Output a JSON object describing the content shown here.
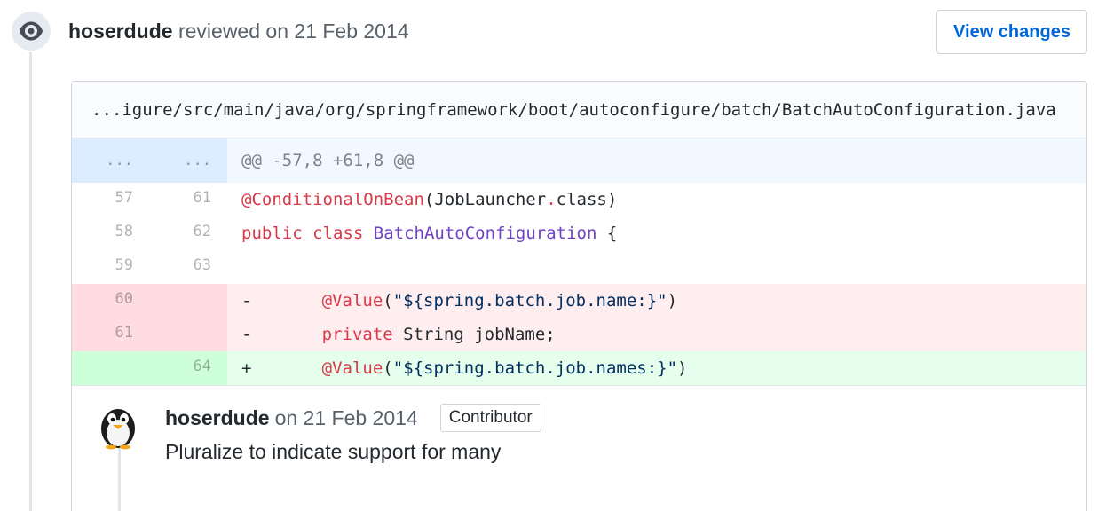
{
  "review": {
    "author": "hoserdude",
    "action": " reviewed on 21 Feb 2014",
    "view_changes_label": "View changes"
  },
  "file": {
    "path": "...igure/src/main/java/org/springframework/boot/autoconfigure/batch/BatchAutoConfiguration.java"
  },
  "hunk": {
    "left": "...",
    "right": "...",
    "header": "@@ -57,8 +61,8 @@"
  },
  "lines": [
    {
      "type": "ctx",
      "old": "57",
      "new": "61"
    },
    {
      "type": "ctx",
      "old": "58",
      "new": "62"
    },
    {
      "type": "ctx",
      "old": "59",
      "new": "63"
    },
    {
      "type": "del",
      "old": "60",
      "new": ""
    },
    {
      "type": "del",
      "old": "61",
      "new": ""
    },
    {
      "type": "add",
      "old": "",
      "new": "64"
    }
  ],
  "code": {
    "l1": {
      "annotation": "@ConditionalOnBean",
      "open": "(JobLauncher",
      "dot": ".",
      "rest": "class)"
    },
    "l2": {
      "kw1": "public",
      "kw2": "class",
      "name": "BatchAutoConfiguration",
      "brace": " {"
    },
    "l4": {
      "marker": "-",
      "annotation": "@Value",
      "open": "(",
      "string": "\"${spring.batch.job.name:}\"",
      "close": ")"
    },
    "l5": {
      "marker": "-",
      "kw": "private",
      "rest": " String jobName;"
    },
    "l6": {
      "marker": "+",
      "annotation": "@Value",
      "open": "(",
      "string": "\"${spring.batch.job.names:}\"",
      "close": ")"
    }
  },
  "comment": {
    "author": "hoserdude",
    "date": "on 21 Feb 2014",
    "role_badge": "Contributor",
    "body": "Pluralize to indicate support for many"
  },
  "colors": {
    "link": "#0366d6",
    "deletion": "#ffeef0",
    "addition": "#e6ffed",
    "hunk": "#f1f8ff"
  }
}
